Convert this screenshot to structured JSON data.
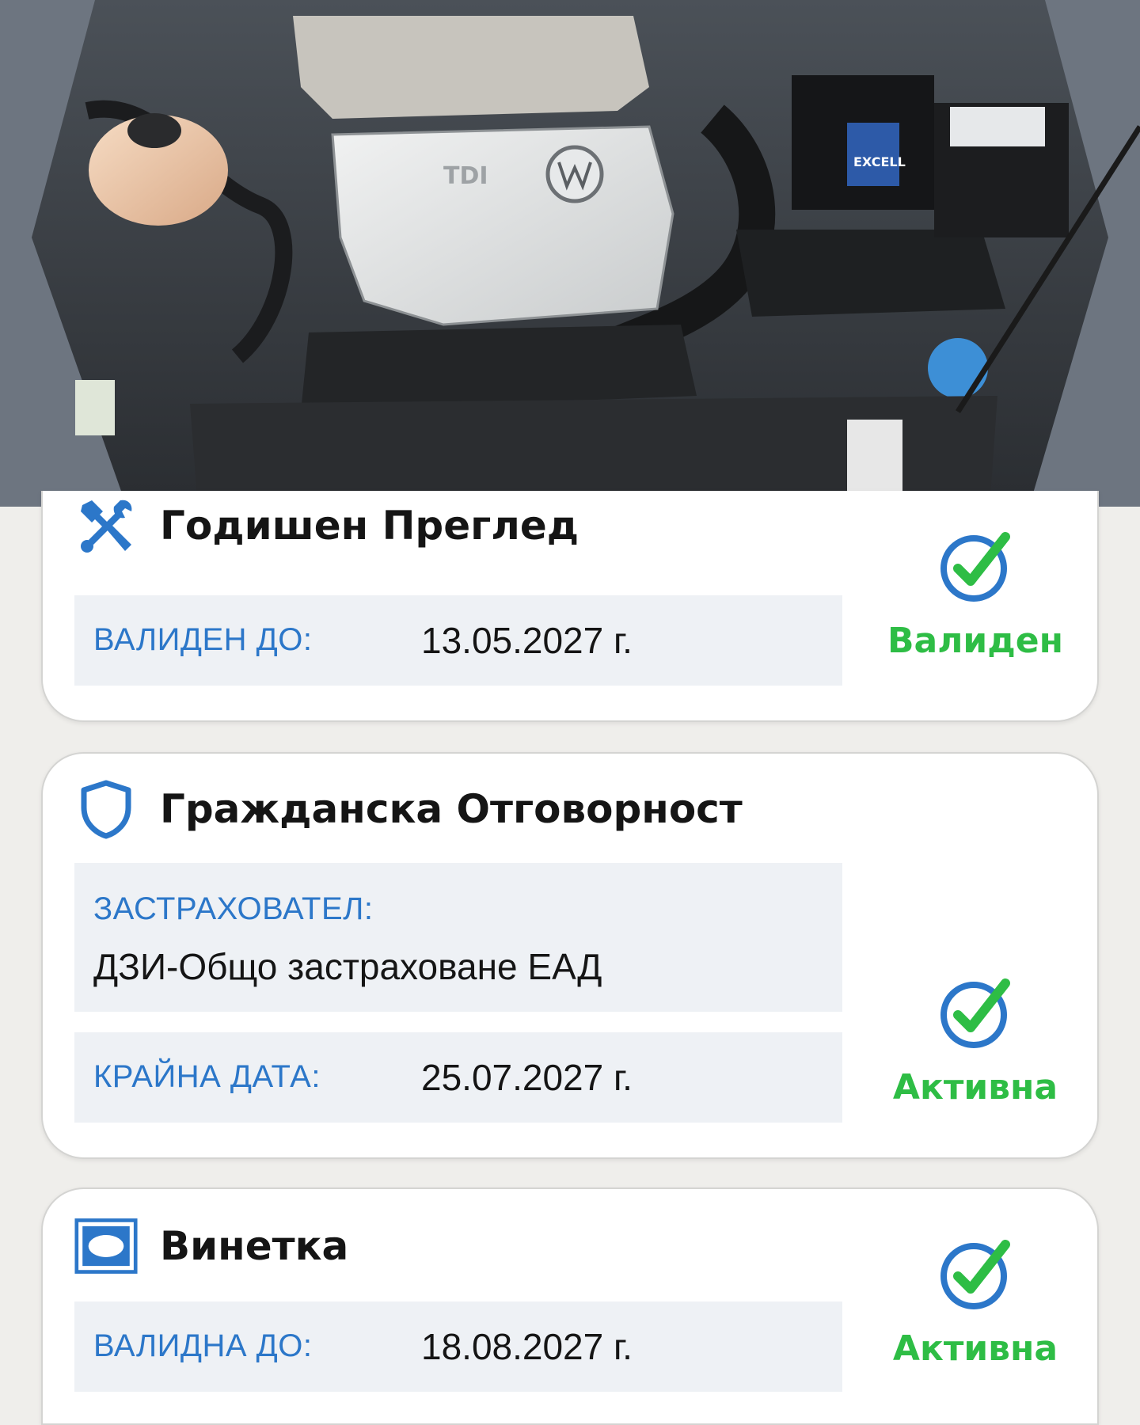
{
  "photo": {
    "engine_badge": "TDI",
    "battery_brand": "EXCELL"
  },
  "colors": {
    "accent_blue": "#2c77c9",
    "status_green": "#2ebd45",
    "row_bg": "#eef1f5"
  },
  "inspection": {
    "icon": "tools-icon",
    "title": "Годишен Преглед",
    "label": "ВАЛИДЕН ДО:",
    "value": "13.05.2027 г.",
    "status": "Валиден"
  },
  "insurance": {
    "icon": "shield-icon",
    "title": "Гражданска Отговорност",
    "insurer_label": "ЗАСТРАХОВАТЕЛ:",
    "insurer_value": "ДЗИ-Общо застраховане ЕАД",
    "end_label": "КРАЙНА ДАТА:",
    "end_value": "25.07.2027 г.",
    "status": "Активна"
  },
  "vignette": {
    "icon": "vignette-icon",
    "title": "Винетка",
    "label": "ВАЛИДНА ДО:",
    "value": "18.08.2027 г.",
    "status": "Активна"
  }
}
